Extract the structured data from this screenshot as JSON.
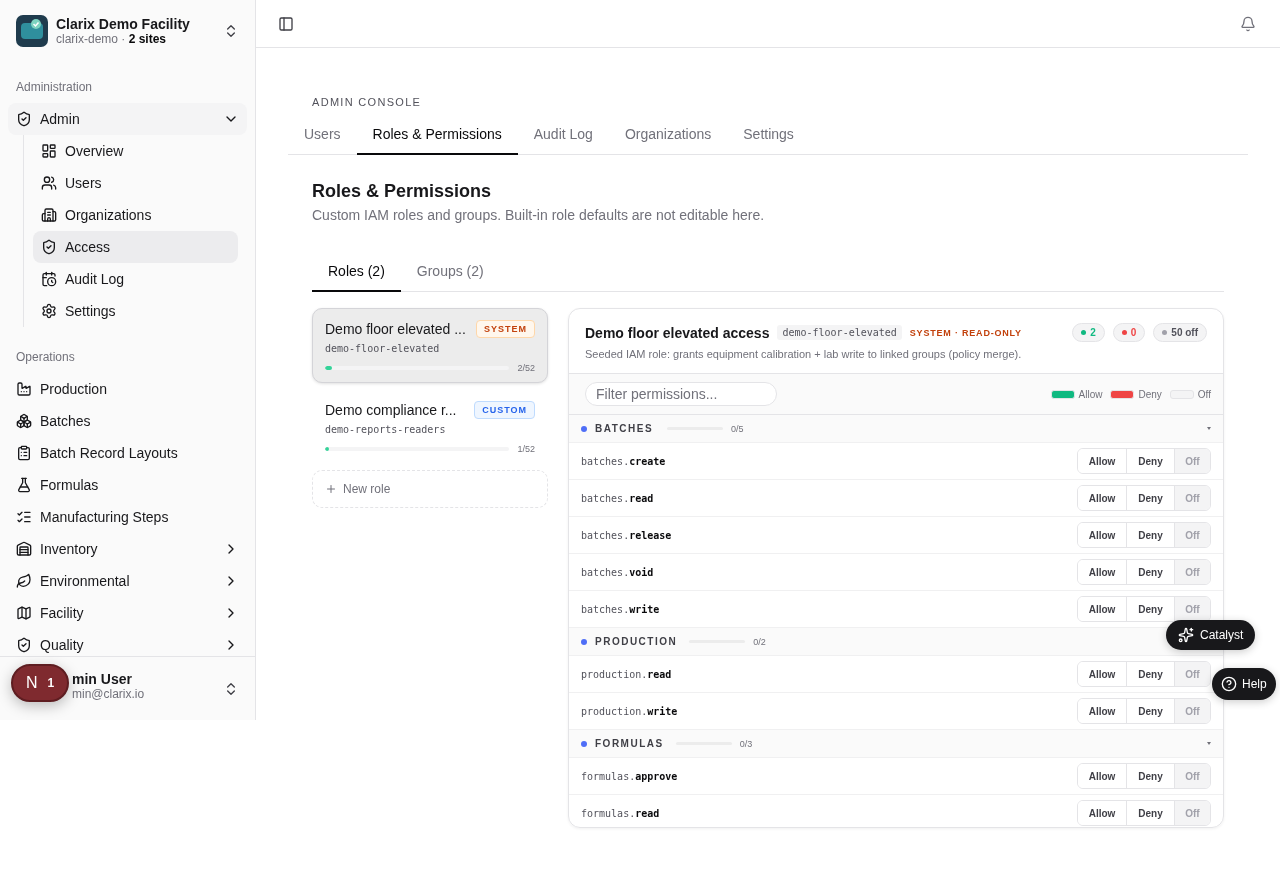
{
  "workspace": {
    "name": "Clarix Demo Facility",
    "subtitle": "clarix-demo · **2 sites**"
  },
  "sidebar": {
    "sections": [
      {
        "title": "Administration",
        "items": [
          {
            "label": "Admin",
            "expanded": true,
            "children": [
              {
                "label": "Overview",
                "selected": false
              },
              {
                "label": "Users",
                "selected": false
              },
              {
                "label": "Organizations",
                "selected": false
              },
              {
                "label": "Access",
                "selected": true
              },
              {
                "label": "Audit Log",
                "selected": false
              },
              {
                "label": "Settings",
                "selected": false
              }
            ]
          }
        ]
      },
      {
        "title": "Operations",
        "items": [
          {
            "label": "Production",
            "selected": false
          },
          {
            "label": "Batches",
            "selected": false
          },
          {
            "label": "Batch Record Layouts",
            "selected": false
          },
          {
            "label": "Formulas",
            "selected": false
          },
          {
            "label": "Manufacturing Steps",
            "selected": false
          },
          {
            "label": "Inventory",
            "expanded": false,
            "selected": false
          },
          {
            "label": "Environmental",
            "expanded": false,
            "selected": false
          },
          {
            "label": "Facility",
            "expanded": false,
            "selected": false
          },
          {
            "label": "Quality",
            "expanded": false,
            "selected": false
          }
        ]
      }
    ]
  },
  "user": {
    "name": "min User",
    "email": "min@clarix.io"
  },
  "dev_badge": {
    "letter": "N",
    "count": "1"
  },
  "console": {
    "eyebrow": "ADMIN CONSOLE",
    "tabs": [
      {
        "label": "Users",
        "selected": false
      },
      {
        "label": "Roles & Permissions",
        "selected": true
      },
      {
        "label": "Audit Log",
        "selected": false
      },
      {
        "label": "Organizations",
        "selected": false
      },
      {
        "label": "Settings",
        "selected": false
      }
    ]
  },
  "page": {
    "title": "Roles & Permissions",
    "subtitle": "Custom IAM roles and groups. Built-in role defaults are not editable here.",
    "tabs": [
      {
        "label": "Roles (2)",
        "selected": true
      },
      {
        "label": "Groups (2)",
        "selected": false
      }
    ]
  },
  "roles": [
    {
      "name": "Demo floor elevated ...",
      "kind": "system",
      "badge": "SYSTEM",
      "slug": "demo-floor-elevated",
      "level": 0.04,
      "count": "2/52",
      "selected": true
    },
    {
      "name": "Demo compliance r...",
      "kind": "custom",
      "badge": "CUSTOM",
      "slug": "demo-reports-readers",
      "level": 0.02,
      "count": "1/52",
      "selected": false
    }
  ],
  "new_role": "New role",
  "detail": {
    "title": "Demo floor elevated access",
    "slug": "demo-floor-elevated",
    "status": "SYSTEM · READ-ONLY",
    "description": "Seeded IAM role: grants equipment calibration + lab write to linked groups (policy merge).",
    "counts": [
      {
        "label": "2",
        "color": "#10b981"
      },
      {
        "label": "0",
        "color": "#ef4444"
      },
      {
        "label": "50 off",
        "color": "#a1a1aa"
      }
    ],
    "filter_placeholder": "Filter permissions...",
    "legend": [
      {
        "label": "Allow",
        "color": "#10b981"
      },
      {
        "label": "Deny",
        "color": "#ef4444"
      },
      {
        "label": "Off",
        "color": "#f4f4f5"
      }
    ],
    "groups": [
      {
        "name": "BATCHES",
        "count": "0/5",
        "level": 0,
        "expanded": true,
        "permissions": [
          {
            "name": "batches.**create**",
            "options": [
              {
                "label": "Allow",
                "selected": false
              },
              {
                "label": "Deny",
                "selected": false
              },
              {
                "label": "Off",
                "selected": true
              }
            ]
          },
          {
            "name": "batches.**read**",
            "options": [
              {
                "label": "Allow",
                "selected": false
              },
              {
                "label": "Deny",
                "selected": false
              },
              {
                "label": "Off",
                "selected": true
              }
            ]
          },
          {
            "name": "batches.**release**",
            "options": [
              {
                "label": "Allow",
                "selected": false
              },
              {
                "label": "Deny",
                "selected": false
              },
              {
                "label": "Off",
                "selected": true
              }
            ]
          },
          {
            "name": "batches.**void**",
            "options": [
              {
                "label": "Allow",
                "selected": false
              },
              {
                "label": "Deny",
                "selected": false
              },
              {
                "label": "Off",
                "selected": true
              }
            ]
          },
          {
            "name": "batches.**write**",
            "options": [
              {
                "label": "Allow",
                "selected": false
              },
              {
                "label": "Deny",
                "selected": false
              },
              {
                "label": "Off",
                "selected": true
              }
            ]
          }
        ]
      },
      {
        "name": "PRODUCTION",
        "count": "0/2",
        "level": 0,
        "expanded": true,
        "permissions": [
          {
            "name": "production.**read**",
            "options": [
              {
                "label": "Allow",
                "selected": false
              },
              {
                "label": "Deny",
                "selected": false
              },
              {
                "label": "Off",
                "selected": true
              }
            ]
          },
          {
            "name": "production.**write**",
            "options": [
              {
                "label": "Allow",
                "selected": false
              },
              {
                "label": "Deny",
                "selected": false
              },
              {
                "label": "Off",
                "selected": true
              }
            ]
          }
        ]
      },
      {
        "name": "FORMULAS",
        "count": "0/3",
        "level": 0,
        "expanded": true,
        "permissions": [
          {
            "name": "formulas.**approve**",
            "options": [
              {
                "label": "Allow",
                "selected": false
              },
              {
                "label": "Deny",
                "selected": false
              },
              {
                "label": "Off",
                "selected": true
              }
            ]
          },
          {
            "name": "formulas.**read**",
            "options": [
              {
                "label": "Allow",
                "selected": false
              },
              {
                "label": "Deny",
                "selected": false
              },
              {
                "label": "Off",
                "selected": true
              }
            ]
          }
        ]
      }
    ]
  },
  "floating": [
    {
      "label": "Catalyst"
    },
    {
      "label": "Help"
    }
  ]
}
